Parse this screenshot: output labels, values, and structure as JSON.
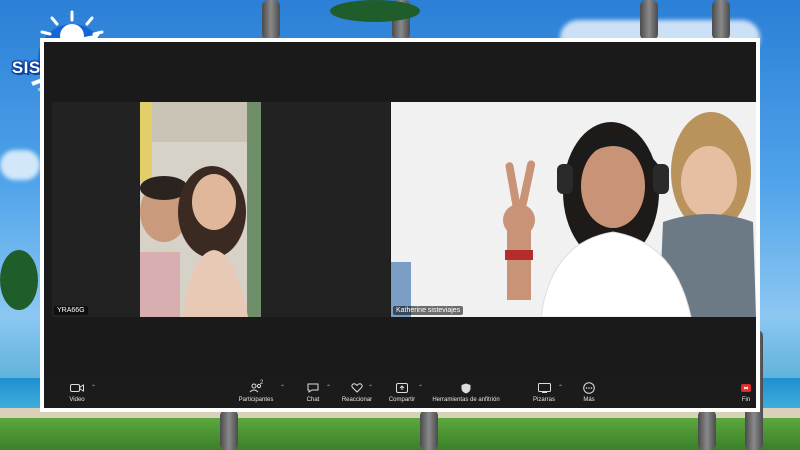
{
  "brand": {
    "logo_text": "SISTE VIAJES"
  },
  "participants": [
    {
      "name": "YRA66G"
    },
    {
      "name": "Katherine sisteviajes"
    }
  ],
  "toolbar": {
    "video": "Video",
    "participants": "Participantes",
    "participants_count": "2",
    "chat": "Chat",
    "react": "Reaccionar",
    "share": "Compartir",
    "apps": "Herramientas de anfitrión",
    "whiteboard": "Pizarras",
    "more": "Más",
    "end": "Fin"
  },
  "colors": {
    "end_accent": "#e02b2b",
    "brand_blue": "#0a3f9e"
  }
}
